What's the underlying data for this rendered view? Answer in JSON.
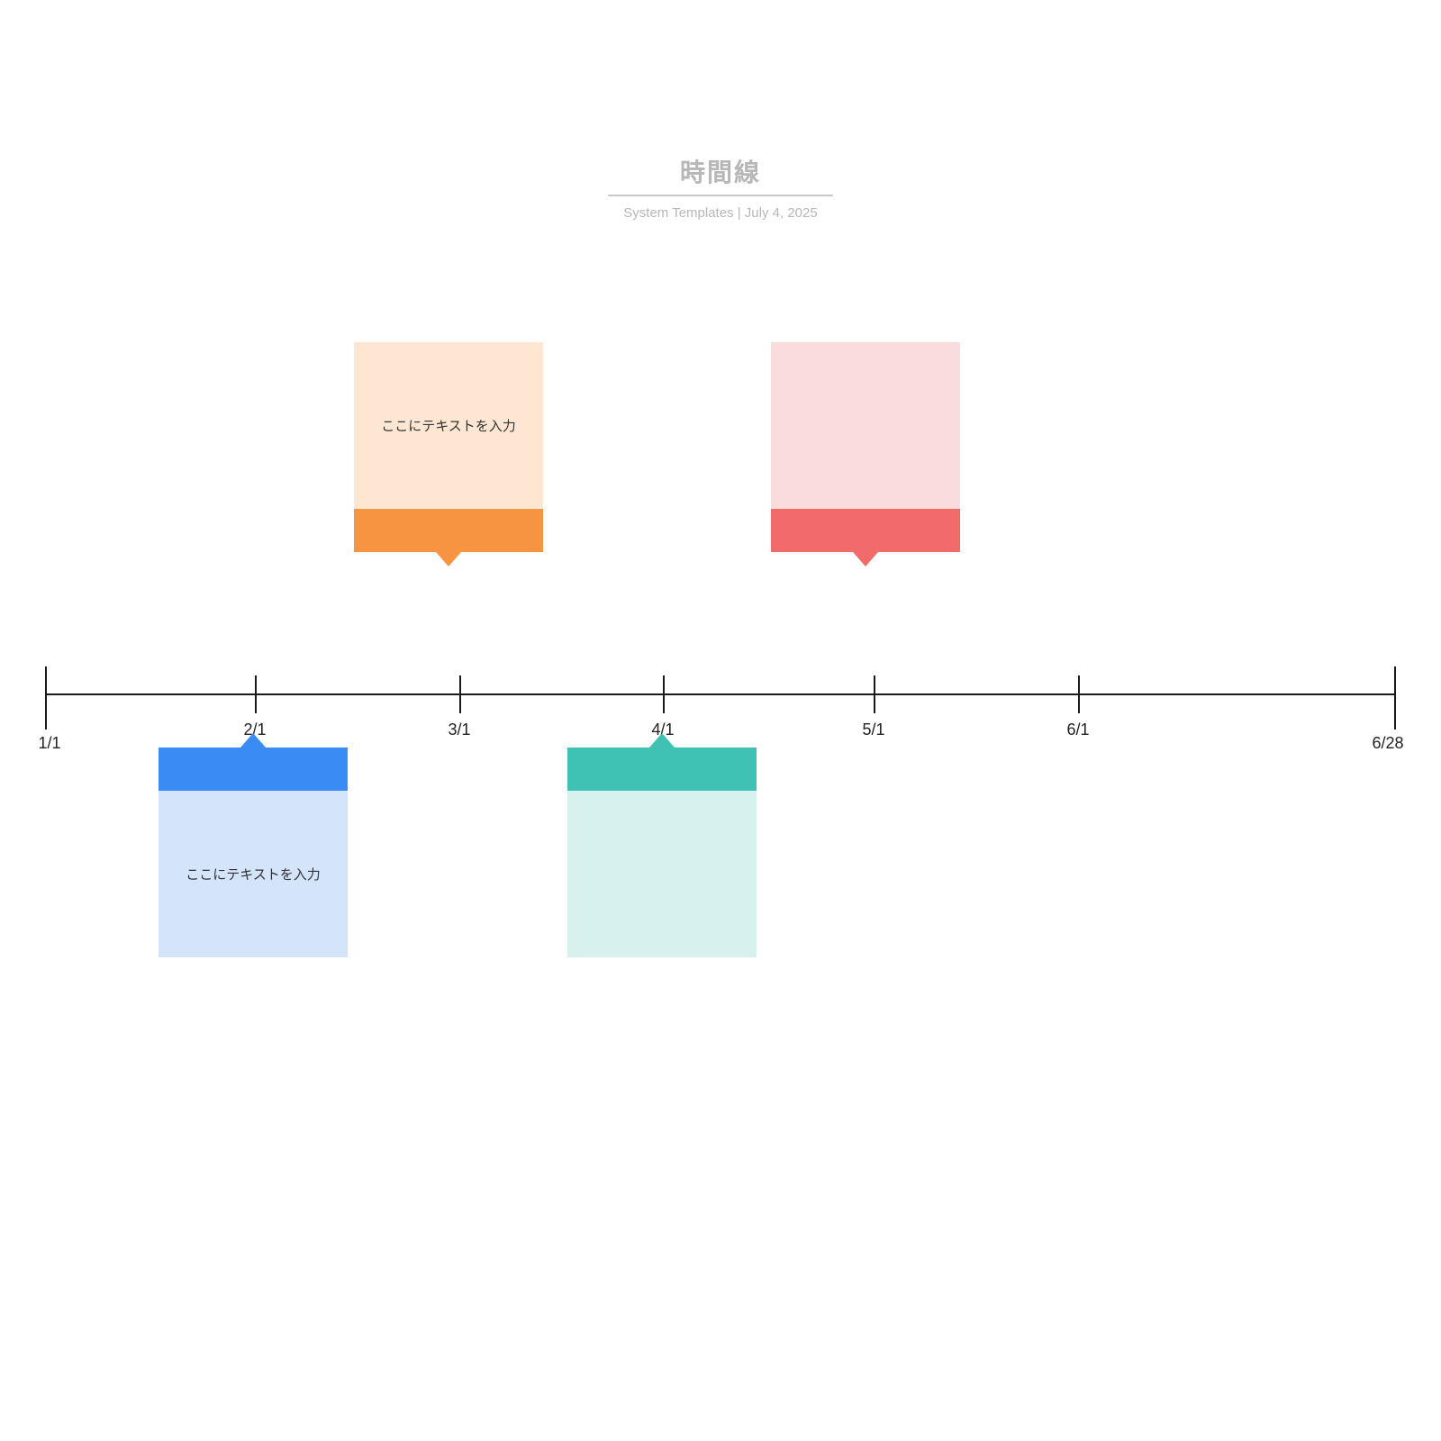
{
  "header": {
    "title": "時間線",
    "subtitle_author": "System Templates",
    "subtitle_sep": "  |  ",
    "subtitle_date": "July 4, 2025"
  },
  "axis": {
    "start_label": "1/1",
    "end_label": "6/28",
    "ticks": [
      {
        "label": "2/1"
      },
      {
        "label": "3/1"
      },
      {
        "label": "4/1"
      },
      {
        "label": "5/1"
      },
      {
        "label": "6/1"
      }
    ]
  },
  "cards": {
    "orange": {
      "text": "ここにテキストを入力"
    },
    "pink": {
      "text": ""
    },
    "blue": {
      "text": "ここにテキストを入力"
    },
    "teal": {
      "text": ""
    }
  },
  "colors": {
    "orange_accent": "#f79442",
    "orange_body": "#fde6d2",
    "pink_accent": "#f26b6b",
    "pink_body": "#fbdcdc",
    "blue_accent": "#3a8bf4",
    "blue_body": "#d3e4fb",
    "teal_accent": "#3fc1b3",
    "teal_body": "#d6f1ee"
  }
}
